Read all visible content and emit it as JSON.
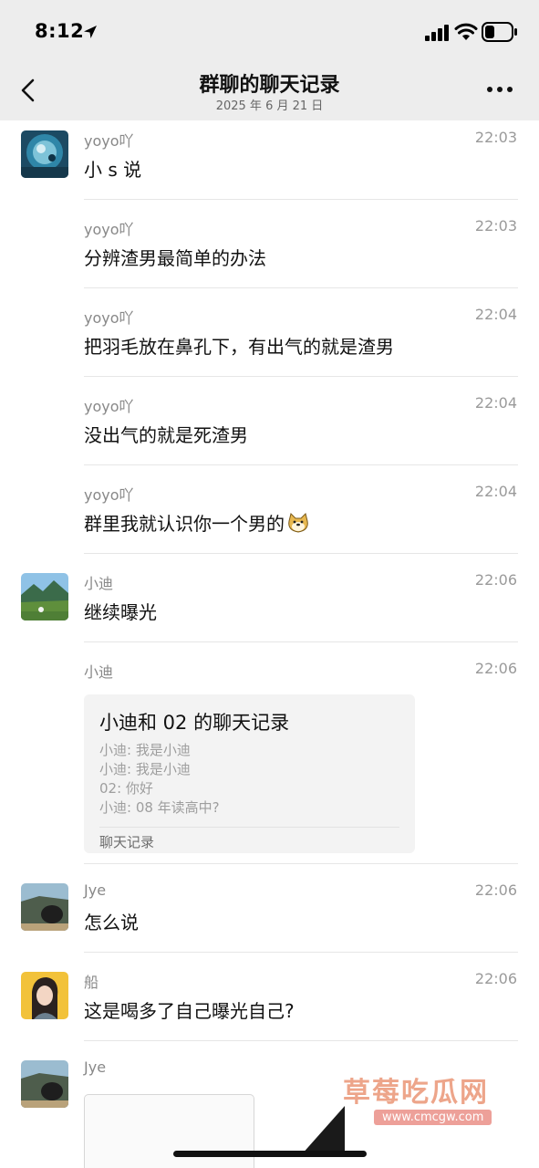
{
  "status": {
    "time": "8:12"
  },
  "nav": {
    "title": "群聊的聊天记录",
    "date": "2025 年 6 月 21 日"
  },
  "messages": [
    {
      "sender": "yoyo吖",
      "time": "22:03",
      "text": "小 s 说"
    },
    {
      "sender": "yoyo吖",
      "time": "22:03",
      "text": "分辨渣男最简单的办法"
    },
    {
      "sender": "yoyo吖",
      "time": "22:04",
      "text": "把羽毛放在鼻孔下，有出气的就是渣男"
    },
    {
      "sender": "yoyo吖",
      "time": "22:04",
      "text": "没出气的就是死渣男"
    },
    {
      "sender": "yoyo吖",
      "time": "22:04",
      "text": "群里我就认识你一个男的"
    },
    {
      "sender": "小迪",
      "time": "22:06",
      "text": "继续曝光"
    },
    {
      "sender": "小迪",
      "time": "22:06",
      "card": {
        "title": "小迪和 02 的聊天记录",
        "lines": [
          "小迪: 我是小迪",
          "小迪: 我是小迪",
          "02: 你好",
          "小迪: 08 年读高中?"
        ],
        "footer": "聊天记录"
      }
    },
    {
      "sender": "Jye",
      "time": "22:06",
      "text": "怎么说"
    },
    {
      "sender": "船",
      "time": "22:06",
      "text": "这是喝多了自己曝光自己?"
    },
    {
      "sender": "Jye",
      "time": ""
    }
  ],
  "watermark": {
    "title": "草莓吃瓜网",
    "url": "www.cmcgw.com"
  }
}
